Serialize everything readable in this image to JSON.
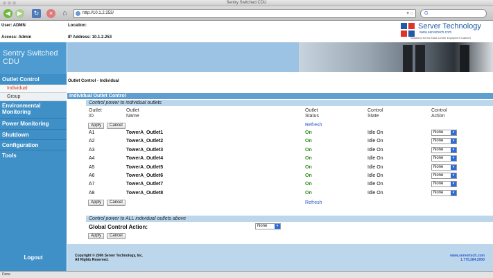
{
  "window": {
    "title": "Sentry Switched CDU"
  },
  "browser": {
    "url": "http://10.1.2.253/",
    "search_text": "G",
    "status_text": "Done"
  },
  "header": {
    "user": "User: ADMN",
    "access": "Access: Admin",
    "location": "Location:",
    "ip_address": "IP Address: 10.1.2.253"
  },
  "logo": {
    "name": "Server Technology",
    "url": "www.servertech.com",
    "tagline": "Solutions for the Data Center Equipment Cabinet"
  },
  "sidebar": {
    "title": "Sentry Switched CDU",
    "items": [
      {
        "label": "Outlet Control"
      },
      {
        "label": "Individual",
        "active": true
      },
      {
        "label": "Group"
      },
      {
        "label": "Environmental Monitoring"
      },
      {
        "label": "Power Monitoring"
      },
      {
        "label": "Shutdown"
      },
      {
        "label": "Configuration"
      },
      {
        "label": "Tools"
      }
    ],
    "logout": "Logout"
  },
  "content": {
    "breadcrumb": "Outlet Control - Individual",
    "section_title": "Individual Outlet Control",
    "subsection_title": "Control power to individual outlets",
    "columns": {
      "outlet_id": "Outlet ID",
      "outlet_name": "Outlet Name",
      "outlet_status": "Outlet Status",
      "control_state": "Control State",
      "control_action": "Control Action"
    },
    "apply_label": "Apply",
    "cancel_label": "Cancel",
    "refresh_label": "Refresh",
    "rows": [
      {
        "id": "A1",
        "name": "TowerA_Outlet1",
        "status": "On",
        "state": "Idle On",
        "action": "None"
      },
      {
        "id": "A2",
        "name": "TowerA_Outlet2",
        "status": "On",
        "state": "Idle On",
        "action": "None"
      },
      {
        "id": "A3",
        "name": "TowerA_Outlet3",
        "status": "On",
        "state": "Idle On",
        "action": "None"
      },
      {
        "id": "A4",
        "name": "TowerA_Outlet4",
        "status": "On",
        "state": "Idle On",
        "action": "None"
      },
      {
        "id": "A5",
        "name": "TowerA_Outlet5",
        "status": "On",
        "state": "Idle On",
        "action": "None"
      },
      {
        "id": "A6",
        "name": "TowerA_Outlet6",
        "status": "On",
        "state": "Idle On",
        "action": "None"
      },
      {
        "id": "A7",
        "name": "TowerA_Outlet7",
        "status": "On",
        "state": "Idle On",
        "action": "None"
      },
      {
        "id": "A8",
        "name": "TowerA_Outlet8",
        "status": "On",
        "state": "Idle On",
        "action": "None"
      }
    ],
    "global_subsection_title": "Control power to ALL individual outlets above",
    "global_label": "Global Control Action:",
    "global_action": "None"
  },
  "footer": {
    "copyright_line1": "Copyright © 2006 Server Technology, Inc.",
    "copyright_line2": "All Rights Reserved.",
    "website": "www.servertech.com",
    "phone": "1.775.284.2000"
  },
  "colors": {
    "sidebar": "#3f90c7",
    "section_bar": "#5e9fd0",
    "sub_bar": "#bcd7ec",
    "active_nav": "#d43d1a",
    "status_on": "#2e8a1a",
    "link": "#2b58c9"
  }
}
